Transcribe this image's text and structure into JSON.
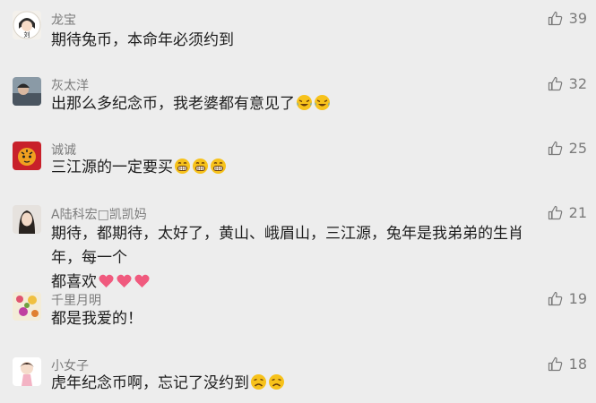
{
  "comments": [
    {
      "name": "龙宝",
      "text": "期待兔币，本命年必须约到",
      "likes": "39",
      "avatar": "cartoon-girl-avatar",
      "emojis": []
    },
    {
      "name": "灰太洋",
      "text": "出那么多纪念币，我老婆都有意见了",
      "likes": "32",
      "avatar": "photo-avatar",
      "emojis": [
        "crying-laughing-emoji",
        "crying-laughing-emoji"
      ]
    },
    {
      "name": "诚诚",
      "text": "三江源的一定要买",
      "likes": "25",
      "avatar": "tiger-avatar",
      "emojis": [
        "grinning-emoji",
        "grinning-emoji",
        "grinning-emoji"
      ]
    },
    {
      "name": "A陆科宏□凯凯妈",
      "text_line1": "期待，都期待，太好了，黄山、峨眉山，三江源，兔年是我弟弟的生肖年，每一个",
      "text_line2": "都喜欢",
      "likes": "21",
      "avatar": "woman-photo-avatar",
      "emojis": [
        "pink-heart-emoji",
        "pink-heart-emoji",
        "pink-heart-emoji"
      ]
    },
    {
      "name": "千里月明",
      "text": "都是我爱的！",
      "likes": "19",
      "avatar": "flowers-avatar",
      "emojis": []
    },
    {
      "name": "小女子",
      "text": "虎年纪念币啊，忘记了没约到",
      "likes": "18",
      "avatar": "doll-avatar",
      "emojis": [
        "sad-face-emoji",
        "sad-face-emoji"
      ]
    }
  ],
  "colors": {
    "background": "#ededed",
    "name": "#7b7b7b",
    "text": "#1d1d1d",
    "heart": "#f05a7e",
    "emoji": "#f7c21b"
  }
}
